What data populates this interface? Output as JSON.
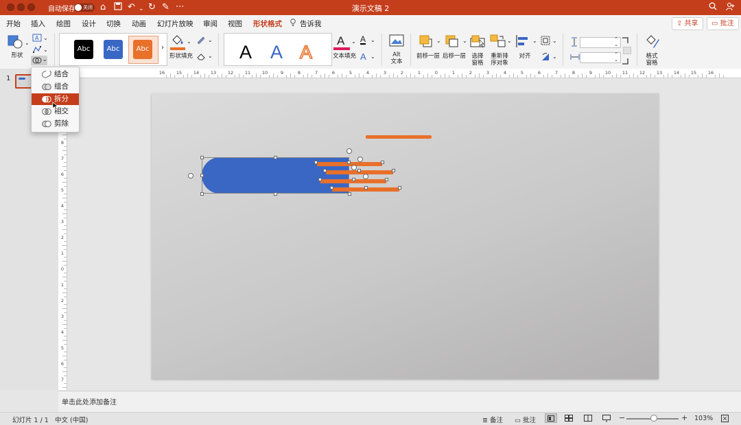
{
  "titlebar": {
    "autosave_label": "自动保存",
    "autosave_state": "关闭",
    "doc_title": "演示文稿 2"
  },
  "tabs": [
    {
      "label": "开始"
    },
    {
      "label": "插入"
    },
    {
      "label": "绘图"
    },
    {
      "label": "设计"
    },
    {
      "label": "切换"
    },
    {
      "label": "动画"
    },
    {
      "label": "幻灯片放映"
    },
    {
      "label": "审阅"
    },
    {
      "label": "视图"
    },
    {
      "label": "形状格式",
      "active": true
    },
    {
      "label": "告诉我"
    }
  ],
  "top_buttons": {
    "share": "共享",
    "comment": "批注"
  },
  "ribbon": {
    "shape_label": "形状",
    "style_swatches": [
      {
        "text": "Abc",
        "bg": "#000000",
        "fg": "#ffffff"
      },
      {
        "text": "Abc",
        "bg": "#3a67c4",
        "fg": "#ffffff"
      },
      {
        "text": "Abc",
        "bg": "#e8702a",
        "fg": "#ffffff"
      }
    ],
    "shape_fill_label": "形状填充",
    "fill_color": "#e8702a",
    "wordart": [
      {
        "text": "A",
        "color": "#000000"
      },
      {
        "text": "A",
        "color": "#3a67c4"
      },
      {
        "text": "A",
        "color": "#e8702a"
      }
    ],
    "text_fill_label": "文本填充",
    "text_fill_color": "#e0195f",
    "alt_text_line1": "Alt",
    "alt_text_line2": "文本",
    "bring_forward_label": "前移一层",
    "send_backward_label": "后移一层",
    "selection_pane_line1": "选择",
    "selection_pane_line2": "窗格",
    "reorder_line1": "重新排",
    "reorder_line2": "序对象",
    "align_label": "对齐",
    "format_pane_line1": "格式",
    "format_pane_line2": "窗格"
  },
  "merge_menu": {
    "items": [
      {
        "label": "结合"
      },
      {
        "label": "组合"
      },
      {
        "label": "拆分",
        "selected": true
      },
      {
        "label": "相交"
      },
      {
        "label": "剪除"
      }
    ]
  },
  "ruler": {
    "h_labels": [
      "16",
      "15",
      "14",
      "13",
      "12",
      "11",
      "10",
      "9",
      "8",
      "7",
      "6",
      "5",
      "4",
      "3",
      "2",
      "1",
      "0",
      "1",
      "2",
      "3",
      "4",
      "5",
      "6",
      "7",
      "8",
      "9",
      "10",
      "11",
      "12",
      "13",
      "14",
      "15",
      "16"
    ],
    "v_labels": [
      "9",
      "8",
      "7",
      "6",
      "5",
      "4",
      "3",
      "2",
      "1",
      "0",
      "1",
      "2",
      "3",
      "4",
      "5",
      "6",
      "7",
      "8",
      "9"
    ]
  },
  "thumbnail": {
    "number": "1"
  },
  "notes_placeholder": "单击此处添加备注",
  "statusbar": {
    "slide_info": "幻灯片 1 / 1",
    "language": "中文 (中国)",
    "notes": "备注",
    "comments": "批注",
    "zoom": "103%",
    "zoom_level": 0.52
  },
  "colors": {
    "accent": "#c43e1c",
    "blue_shape": "#3a67c4",
    "orange_shape": "#e8702a"
  },
  "icons": [
    "search-icon",
    "share-people-icon",
    "home-icon",
    "save-icon",
    "undo-icon",
    "redo-icon",
    "edit-icon",
    "more-icon",
    "shapes-icon",
    "text-box-icon",
    "edit-shape-icon",
    "merge-shapes-icon",
    "paint-bucket-icon",
    "pen-icon",
    "eraser-icon",
    "text-outline-icon",
    "text-effect-icon",
    "alt-text-icon",
    "bring-forward-icon",
    "send-backward-icon",
    "selection-pane-icon",
    "reorder-icon",
    "align-icon",
    "group-icon",
    "rotate-icon",
    "height-icon",
    "width-icon",
    "crop-icon",
    "format-pane-icon",
    "notes-icon",
    "comments-icon",
    "normal-view-icon",
    "slide-sorter-icon",
    "reading-view-icon",
    "slideshow-icon",
    "fit-slide-icon"
  ]
}
